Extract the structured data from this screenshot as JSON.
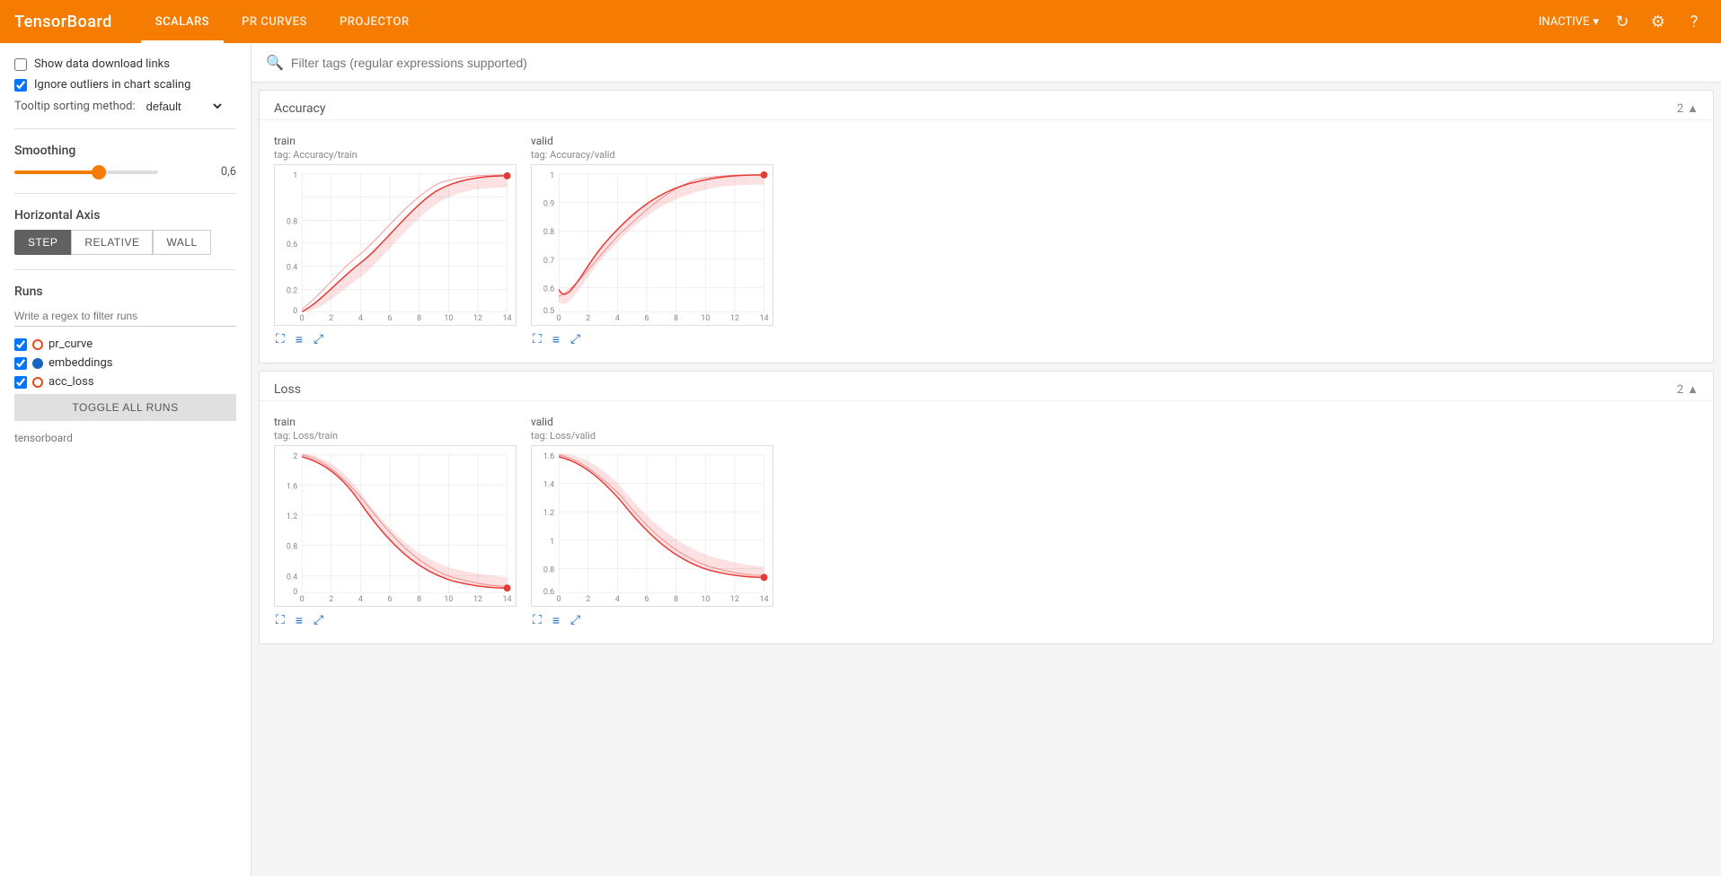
{
  "header": {
    "logo": "TensorBoard",
    "nav": [
      {
        "label": "SCALARS",
        "active": true
      },
      {
        "label": "PR CURVES",
        "active": false
      },
      {
        "label": "PROJECTOR",
        "active": false
      }
    ],
    "status": "INACTIVE",
    "icons": [
      "refresh",
      "settings",
      "help"
    ]
  },
  "sidebar": {
    "show_download_links": {
      "label": "Show data download links",
      "checked": false
    },
    "ignore_outliers": {
      "label": "Ignore outliers in chart scaling",
      "checked": true
    },
    "tooltip_label": "Tooltip sorting method:",
    "tooltip_value": "default",
    "smoothing_label": "Smoothing",
    "smoothing_value": "0,6",
    "smoothing_slider_value": 0.6,
    "horizontal_axis_label": "Horizontal Axis",
    "axis_buttons": [
      {
        "label": "STEP",
        "active": true
      },
      {
        "label": "RELATIVE",
        "active": false
      },
      {
        "label": "WALL",
        "active": false
      }
    ],
    "runs_label": "Runs",
    "runs_filter_placeholder": "Write a regex to filter runs",
    "runs": [
      {
        "name": "pr_curve",
        "color": "orange",
        "checked": true
      },
      {
        "name": "embeddings",
        "color": "blue",
        "checked": true
      },
      {
        "name": "acc_loss",
        "color": "orange",
        "checked": true
      }
    ],
    "toggle_all_label": "TOGGLE ALL RUNS",
    "footer_label": "tensorboard"
  },
  "filter": {
    "placeholder": "Filter tags (regular expressions supported)"
  },
  "sections": [
    {
      "title": "Accuracy",
      "count": "2",
      "charts": [
        {
          "title": "train",
          "tag": "tag: Accuracy/train",
          "type": "accuracy_train",
          "ymax": 1,
          "ymin": 0,
          "xmax": 14
        },
        {
          "title": "valid",
          "tag": "tag: Accuracy/valid",
          "type": "accuracy_valid",
          "ymax": 1,
          "ymin": 0.5,
          "xmax": 14
        }
      ]
    },
    {
      "title": "Loss",
      "count": "2",
      "charts": [
        {
          "title": "train",
          "tag": "tag: Loss/train",
          "type": "loss_train",
          "ymax": 2,
          "ymin": 0,
          "xmax": 14
        },
        {
          "title": "valid",
          "tag": "tag: Loss/valid",
          "type": "loss_valid",
          "ymax": 1.6,
          "ymin": 0,
          "xmax": 14
        }
      ]
    }
  ]
}
